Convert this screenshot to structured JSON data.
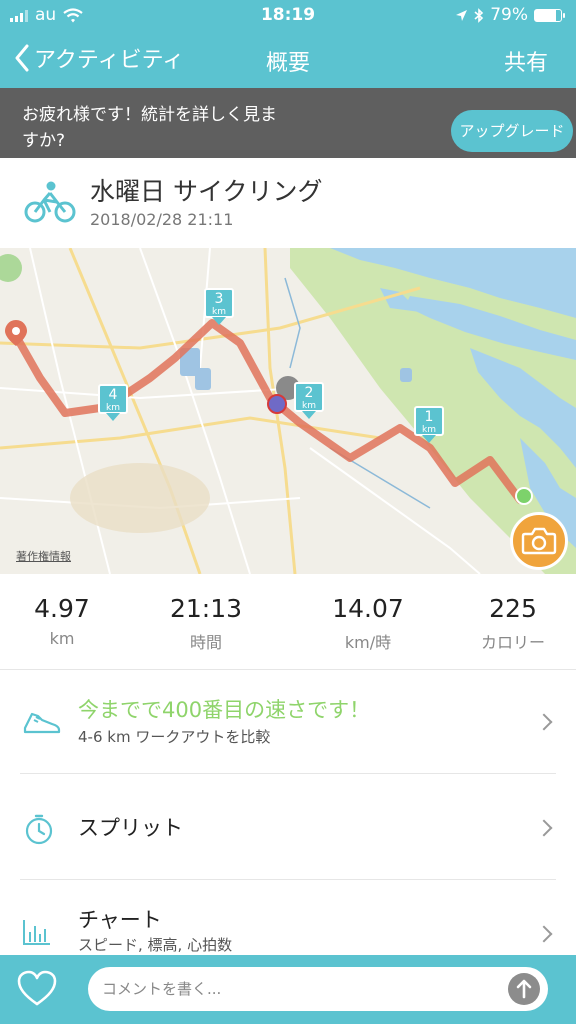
{
  "status_bar": {
    "carrier": "au",
    "time": "18:19",
    "battery": "79%",
    "battery_level": 0.79
  },
  "nav": {
    "back_label": "アクティビティ",
    "title": "概要",
    "share_label": "共有"
  },
  "upsell": {
    "message": "お疲れ様です！統計を詳しく見ますか?",
    "button_label": "アップグレード"
  },
  "activity": {
    "title": "水曜日 サイクリング",
    "datetime": "2018/02/28 21:11"
  },
  "map": {
    "copyright_label": "著作権情報",
    "route_color": "#e0735a",
    "markers": [
      {
        "number": "1",
        "unit": "km"
      },
      {
        "number": "2",
        "unit": "km"
      },
      {
        "number": "3",
        "unit": "km"
      },
      {
        "number": "4",
        "unit": "km"
      }
    ]
  },
  "stats": [
    {
      "value": "4.97",
      "label": "km"
    },
    {
      "value": "21:13",
      "label": "時間"
    },
    {
      "value": "14.07",
      "label": "km/時"
    },
    {
      "value": "225",
      "label": "カロリー"
    }
  ],
  "rows": {
    "achievement": {
      "title": "今までで400番目の速さです！",
      "subtitle": "4-6 km ワークアウトを比較",
      "title_color": "#8fd46b"
    },
    "splits": {
      "title": "スプリット"
    },
    "chart": {
      "title": "チャート",
      "subtitle": "スピード, 標高, 心拍数"
    }
  },
  "comment": {
    "placeholder": "コメントを書く..."
  },
  "colors": {
    "accent": "#5bc3d0",
    "upsell_bg": "#5f5f5f",
    "camera": "#f0a43c"
  },
  "icons": [
    "bicycle-icon",
    "shoe-icon",
    "stopwatch-icon",
    "bar-chart-icon",
    "heart-icon",
    "camera-icon",
    "send-arrow-icon",
    "chevron-right-icon",
    "back-chevron-icon",
    "wifi-icon",
    "location-arrow-icon",
    "bluetooth-icon"
  ]
}
